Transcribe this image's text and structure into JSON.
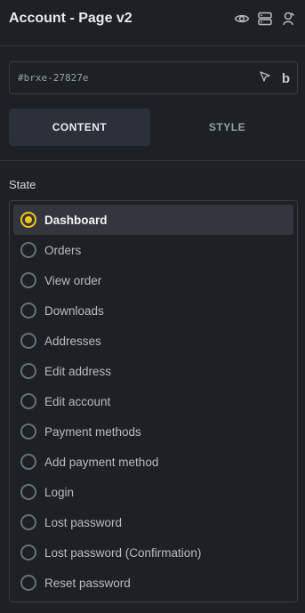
{
  "header": {
    "title": "Account - Page v2",
    "icons": [
      "eye-icon",
      "layers-icon",
      "user-icon"
    ]
  },
  "element_id": {
    "value": "#brxe-27827e",
    "icons": [
      "cursor-icon",
      "bold-b-icon"
    ],
    "b_glyph": "b"
  },
  "tabs": [
    {
      "label": "CONTENT",
      "active": true
    },
    {
      "label": "STYLE",
      "active": false
    }
  ],
  "state": {
    "label": "State",
    "selected": "Dashboard",
    "options": [
      "Dashboard",
      "Orders",
      "View order",
      "Downloads",
      "Addresses",
      "Edit address",
      "Edit account",
      "Payment methods",
      "Add payment method",
      "Login",
      "Lost password",
      "Lost password (Confirmation)",
      "Reset password"
    ]
  },
  "colors": {
    "background": "#1d2024",
    "accent": "#f5c518",
    "active_tab": "#2c3139"
  }
}
